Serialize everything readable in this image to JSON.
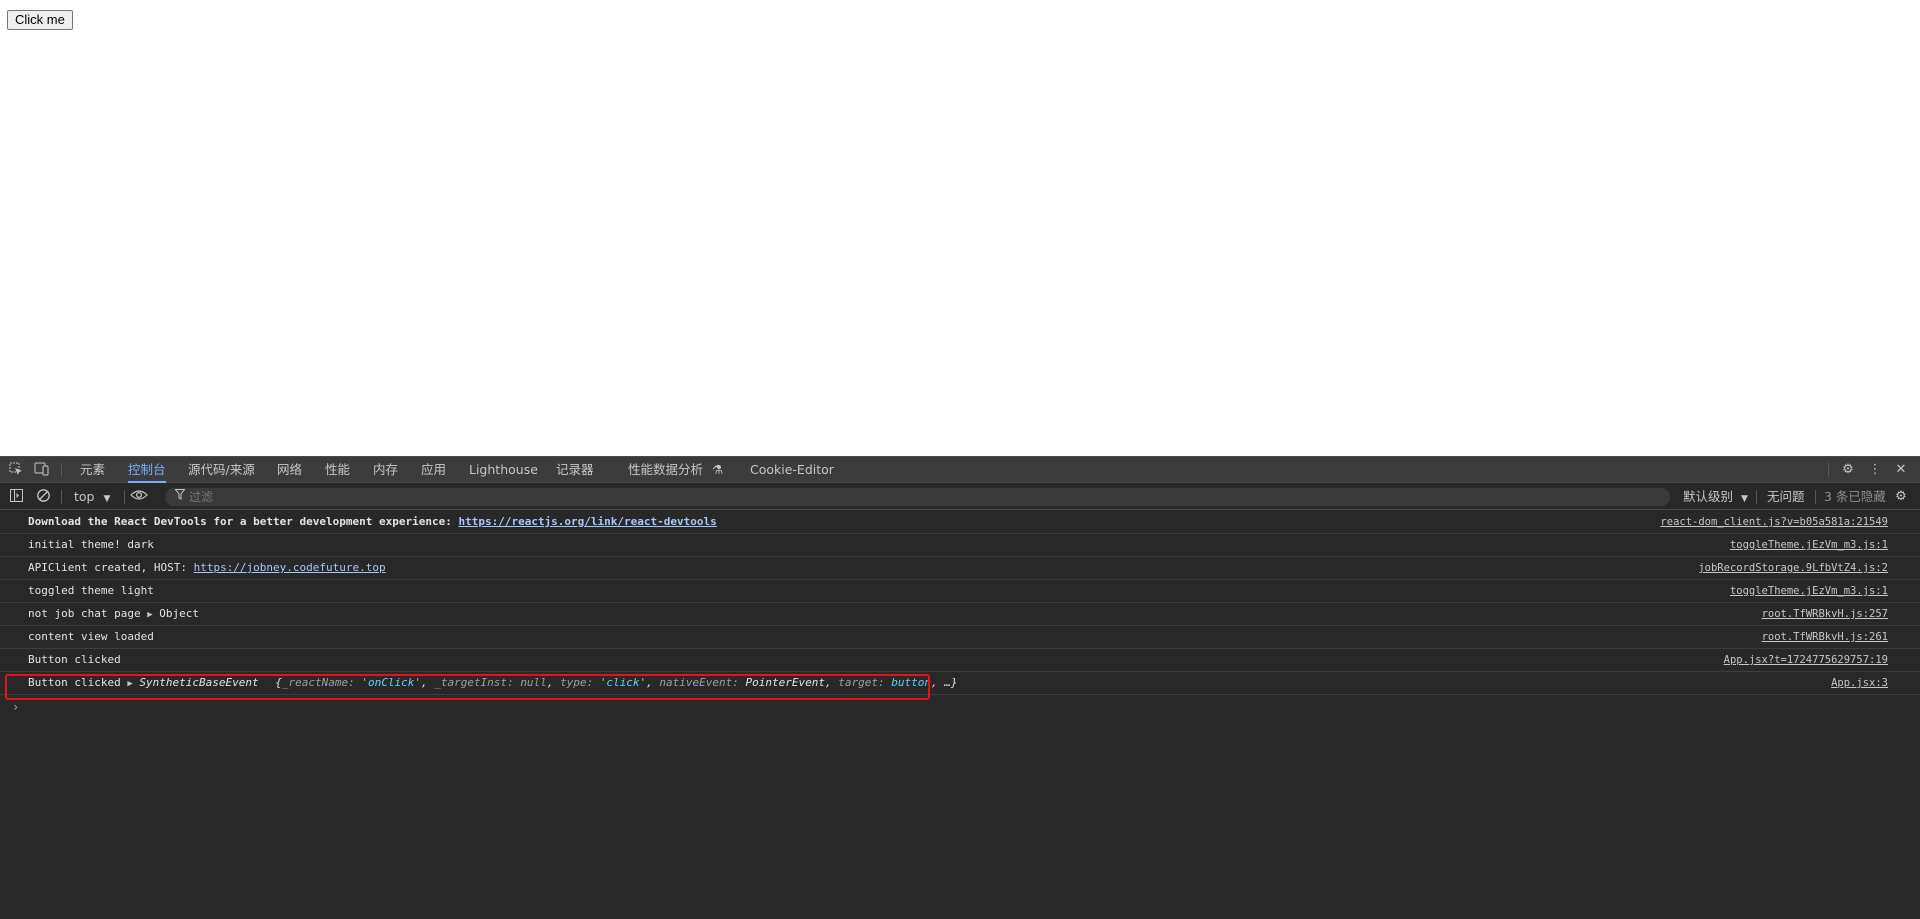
{
  "page": {
    "button_label": "Click me"
  },
  "devtools": {
    "tabs": [
      "元素",
      "控制台",
      "源代码/来源",
      "网络",
      "性能",
      "内存",
      "应用",
      "Lighthouse",
      "记录器",
      "性能数据分析",
      "Cookie-Editor"
    ],
    "active_tab": "控制台",
    "toolbar": {
      "context": "top",
      "filter_placeholder": "过滤",
      "levels": "默认级别",
      "issues": "无问题",
      "hidden": "3 条已隐藏"
    },
    "logs": [
      {
        "pre": "Download the React DevTools for a better development experience: ",
        "link": "https://reactjs.org/link/react-devtools",
        "source": "react-dom_client.js?v=b05a581a:21549"
      },
      {
        "text": "initial theme! dark",
        "source": "toggleTheme.jEzVm_m3.js:1"
      },
      {
        "pre": "APIClient created, HOST: ",
        "link": "https://jobney.codefuture.top",
        "source": "jobRecordStorage.9LfbVtZ4.js:2"
      },
      {
        "text": "toggled theme light",
        "source": "toggleTheme.jEzVm_m3.js:1"
      },
      {
        "text": "not job chat page ",
        "obj": "Object",
        "source": "root.TfWRBkvH.js:257"
      },
      {
        "text": "content view loaded",
        "source": "root.TfWRBkvH.js:261"
      },
      {
        "text": "Button clicked",
        "source": "App.jsx?t=1724775629757:19"
      },
      {
        "text": "Button clicked ",
        "obj": "SyntheticBaseEvent",
        "preview": {
          "open": "{",
          "k1": "_reactName",
          "v1": "'onClick'",
          "k2": "_targetInst",
          "v2": "null",
          "k3": "type",
          "v3": "'click'",
          "k4": "nativeEvent",
          "v4": "PointerEvent",
          "k5": "target",
          "v5": "button",
          "close": "…}"
        },
        "source": "App.jsx:3"
      }
    ],
    "prompt": "›"
  }
}
